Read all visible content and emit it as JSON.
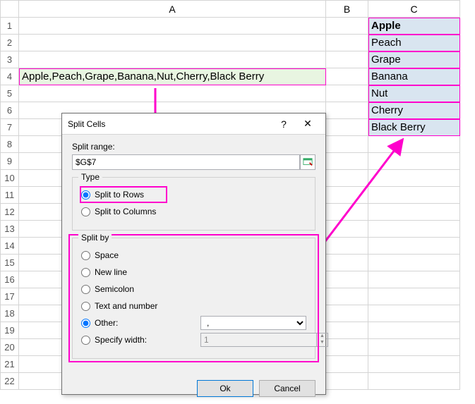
{
  "columns": {
    "a": "A",
    "b": "B",
    "c": "C"
  },
  "rows": [
    "1",
    "2",
    "3",
    "4",
    "5",
    "6",
    "7",
    "8",
    "9",
    "10",
    "11",
    "12",
    "13",
    "14",
    "15",
    "16",
    "17",
    "18",
    "19",
    "20",
    "21",
    "22"
  ],
  "cellA4": "Apple,Peach,Grape,Banana,Nut,Cherry,Black Berry",
  "resultC": [
    "Apple",
    "Peach",
    "Grape",
    "Banana",
    "Nut",
    "Cherry",
    "Black Berry"
  ],
  "dialog": {
    "title": "Split Cells",
    "help": "?",
    "close": "✕",
    "rangeLabel": "Split range:",
    "rangeValue": "$G$7",
    "typeLegend": "Type",
    "typeRows": "Split to Rows",
    "typeCols": "Split to Columns",
    "splitByLegend": "Split by",
    "optSpace": "Space",
    "optNewline": "New line",
    "optSemicolon": "Semicolon",
    "optTextNum": "Text and number",
    "optOther": "Other:",
    "otherValue": ",",
    "optWidth": "Specify width:",
    "widthValue": "1",
    "ok": "Ok",
    "cancel": "Cancel"
  }
}
